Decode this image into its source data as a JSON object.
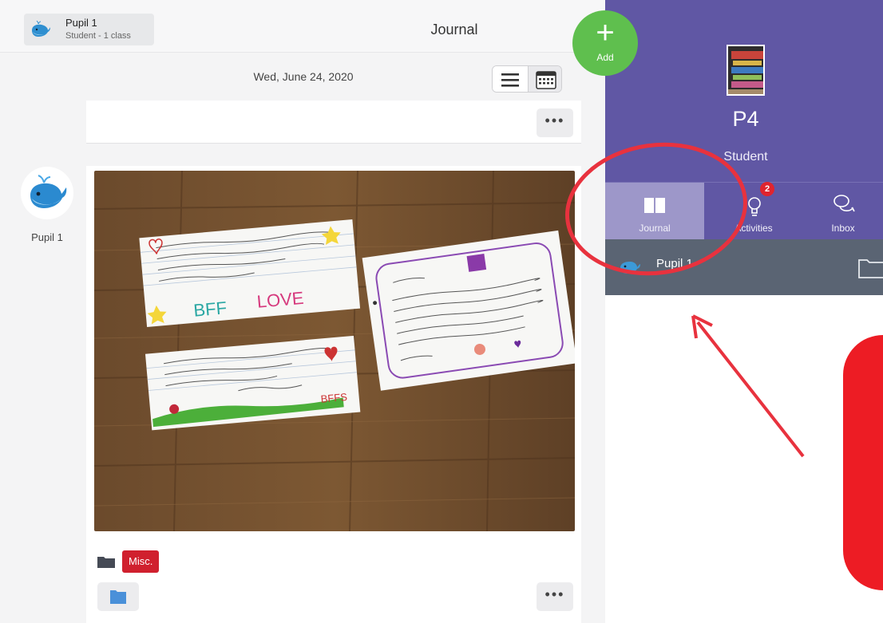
{
  "header": {
    "user_name": "Pupil 1",
    "user_subtitle": "Student - 1 class",
    "title": "Journal"
  },
  "date_row": {
    "date": "Wed, June 24, 2020"
  },
  "add_button": {
    "label": "Add"
  },
  "post": {
    "author": "Pupil 1",
    "folder_tag": "Misc."
  },
  "profile": {
    "class_name": "P4",
    "role": "Student"
  },
  "tabs": [
    {
      "label": "Journal",
      "active": true
    },
    {
      "label": "Activities",
      "badge": "2"
    },
    {
      "label": "Inbox"
    }
  ],
  "student_strip": {
    "label": "Pupil 1"
  },
  "colors": {
    "accent_purple": "#6057a4",
    "add_green": "#5fbf4e",
    "tag_red": "#d0202e",
    "annotation_red": "#ed1c24"
  }
}
